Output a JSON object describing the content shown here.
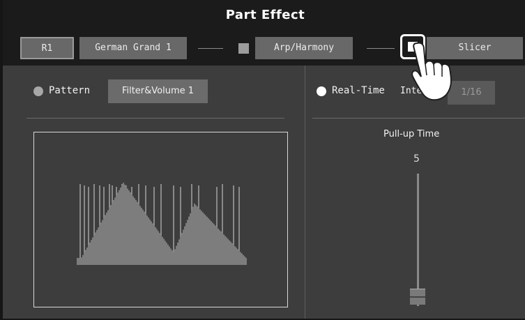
{
  "header": {
    "title": "Part Effect"
  },
  "toolbar": {
    "part": "R1",
    "voice": "German Grand 1",
    "arp": "Arp/Harmony",
    "slicer": "Slicer"
  },
  "left": {
    "pattern_label": "Pattern",
    "pattern_value": "Filter&Volume 1"
  },
  "right": {
    "realtime_label": "Real-Time",
    "interval_label": "Interv",
    "interval_value": "1/16",
    "pullup_label": "Pull-up Time",
    "pullup_value": "5",
    "pullup_slider_level": 0.05
  },
  "colors": {
    "accent_white": "#ffffff",
    "radio_inactive": "#a8a8a8",
    "panel_bg": "#3d3d3d",
    "bar_bg": "#1b1b1b"
  },
  "icons": [
    "hand-pointer-icon",
    "toggle-square-icon"
  ]
}
